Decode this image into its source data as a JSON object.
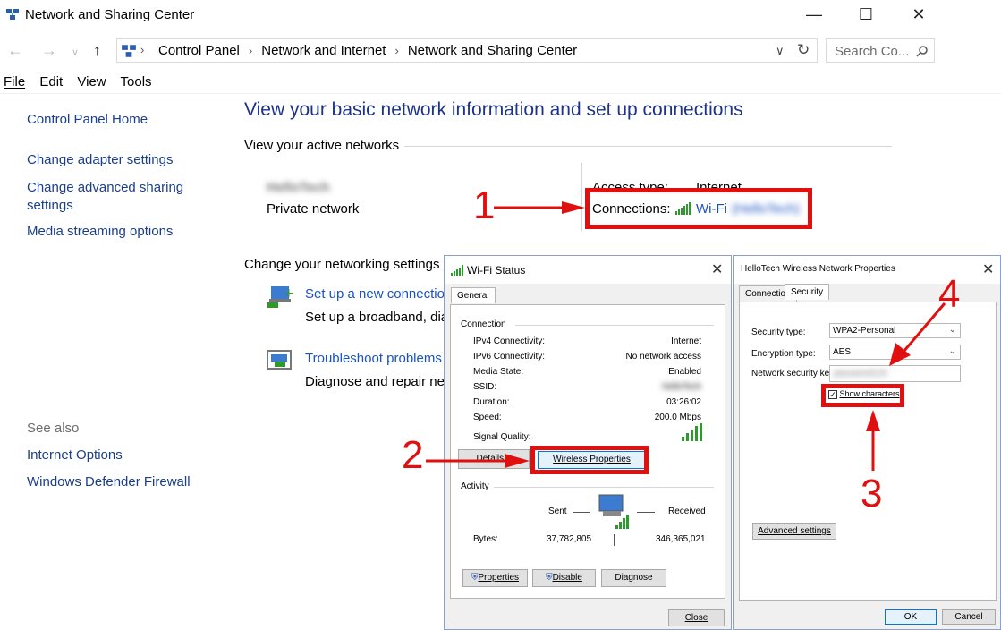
{
  "window": {
    "title": "Network and Sharing Center"
  },
  "address_bar": {
    "crumbs": [
      "Control Panel",
      "Network and Internet",
      "Network and Sharing Center"
    ],
    "search_placeholder": "Search Co..."
  },
  "menu": [
    "File",
    "Edit",
    "View",
    "Tools"
  ],
  "left_nav": {
    "items": [
      "Control Panel Home",
      "Change adapter settings",
      "Change advanced sharing settings",
      "Media streaming options"
    ],
    "see_also_label": "See also",
    "see_also": [
      "Internet Options",
      "Windows Defender Firewall"
    ]
  },
  "main": {
    "title": "View your basic network information and set up connections",
    "active_networks_label": "View your active networks",
    "network_name": "HelloTech",
    "network_type": "Private network",
    "access_type_label": "Access type:",
    "access_type_value": "Internet",
    "connections_label": "Connections:",
    "connection_name": "Wi-Fi",
    "connection_ssid": "(HelloTech)",
    "change_settings_label": "Change your networking settings",
    "setup_link": "Set up a new connection or network",
    "setup_desc": "Set up a broadband, dial-up, or VPN connection",
    "troubleshoot_link": "Troubleshoot problems",
    "troubleshoot_desc": "Diagnose and repair network problems"
  },
  "wifi_status": {
    "title": "Wi-Fi Status",
    "tab": "General",
    "connection_label": "Connection",
    "rows": [
      {
        "label": "IPv4 Connectivity:",
        "value": "Internet"
      },
      {
        "label": "IPv6 Connectivity:",
        "value": "No network access"
      },
      {
        "label": "Media State:",
        "value": "Enabled"
      },
      {
        "label": "SSID:",
        "value": "HelloTech"
      },
      {
        "label": "Duration:",
        "value": "03:26:02"
      },
      {
        "label": "Speed:",
        "value": "200.0 Mbps"
      }
    ],
    "signal_label": "Signal Quality:",
    "details_btn": "Details...",
    "wireless_props_btn": "Wireless Properties",
    "activity_label": "Activity",
    "sent_label": "Sent",
    "received_label": "Received",
    "bytes_label": "Bytes:",
    "bytes_sent": "37,782,805",
    "bytes_received": "346,365,021",
    "properties_btn": "Properties",
    "disable_btn": "Disable",
    "diagnose_btn": "Diagnose",
    "close_btn": "Close"
  },
  "wireless_props": {
    "title": "HelloTech Wireless Network Properties",
    "tabs": [
      "Connection",
      "Security"
    ],
    "security_type_label": "Security type:",
    "security_type_value": "WPA2-Personal",
    "encryption_type_label": "Encryption type:",
    "encryption_type_value": "AES",
    "key_label": "Network security key",
    "key_value": "password123",
    "show_chars_label": "Show characters",
    "advanced_btn": "Advanced settings",
    "ok_btn": "OK",
    "cancel_btn": "Cancel"
  },
  "annotations": [
    "1",
    "2",
    "3",
    "4"
  ],
  "colors": {
    "annotation_red": "#e01010",
    "link_blue": "#1a52c2",
    "title_blue": "#1e3287"
  }
}
